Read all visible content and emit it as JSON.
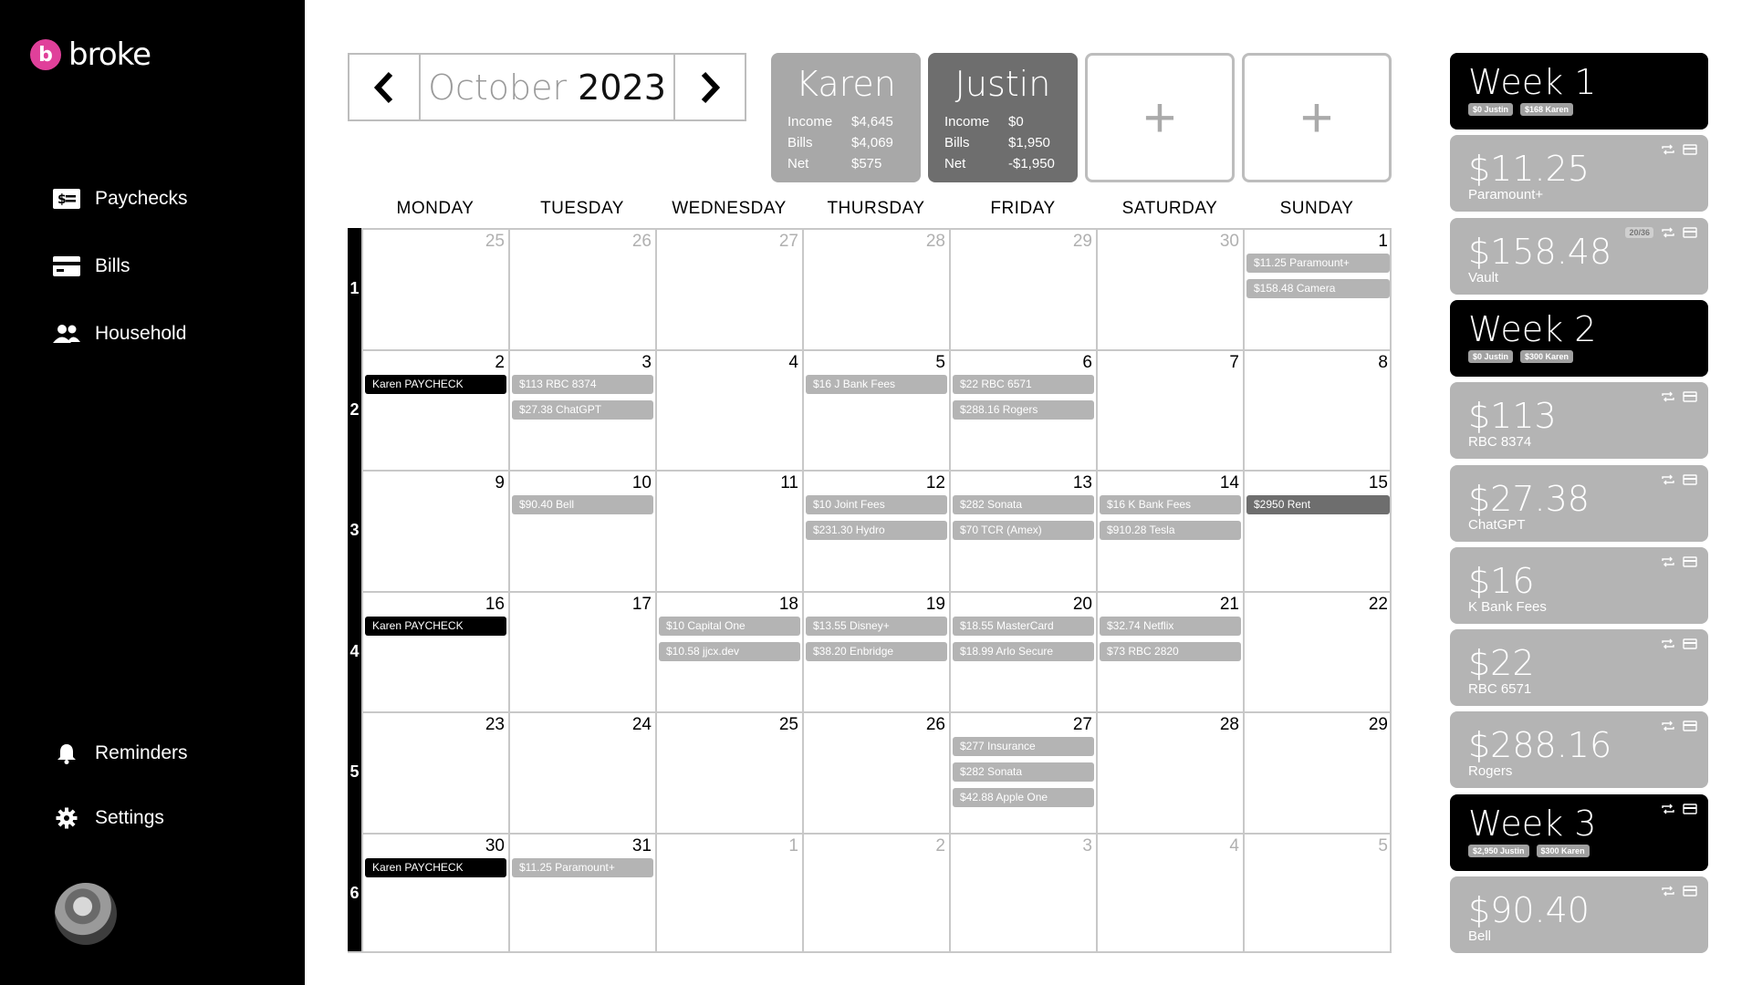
{
  "brand": {
    "name": "broke",
    "mark": "b",
    "accent": "#e0409a"
  },
  "nav": {
    "paychecks": "Paychecks",
    "bills": "Bills",
    "household": "Household",
    "reminders": "Reminders",
    "settings": "Settings"
  },
  "month": {
    "name": "October",
    "year": "2023"
  },
  "people": [
    {
      "name": "Karen",
      "income_label": "Income",
      "income": "$4,645",
      "bills_label": "Bills",
      "bills": "$4,069",
      "net_label": "Net",
      "net": "$575",
      "color": "#a8a8a8"
    },
    {
      "name": "Justin",
      "income_label": "Income",
      "income": "$0",
      "bills_label": "Bills",
      "bills": "$1,950",
      "net_label": "Net",
      "net": "-$1,950",
      "color": "#6e6e6e"
    }
  ],
  "add_label": "+",
  "days_of_week": [
    "MONDAY",
    "TUESDAY",
    "WEDNESDAY",
    "THURSDAY",
    "FRIDAY",
    "SATURDAY",
    "SUNDAY"
  ],
  "weeks": [
    "1",
    "2",
    "3",
    "4",
    "5",
    "6"
  ],
  "calendar": [
    [
      {
        "day": "25",
        "dim": true,
        "events": []
      },
      {
        "day": "26",
        "dim": true,
        "events": []
      },
      {
        "day": "27",
        "dim": true,
        "events": []
      },
      {
        "day": "28",
        "dim": true,
        "events": []
      },
      {
        "day": "29",
        "dim": true,
        "events": []
      },
      {
        "day": "30",
        "dim": true,
        "events": []
      },
      {
        "day": "1",
        "dim": false,
        "events": [
          {
            "label": "$11.25 Paramount+",
            "style": "grey"
          },
          {
            "label": "$158.48 Camera",
            "style": "grey"
          }
        ]
      }
    ],
    [
      {
        "day": "2",
        "dim": false,
        "events": [
          {
            "label": "Karen PAYCHECK",
            "style": "black"
          }
        ]
      },
      {
        "day": "3",
        "dim": false,
        "events": [
          {
            "label": "$113 RBC 8374",
            "style": "grey"
          },
          {
            "label": "$27.38 ChatGPT",
            "style": "grey"
          }
        ]
      },
      {
        "day": "4",
        "dim": false,
        "events": []
      },
      {
        "day": "5",
        "dim": false,
        "events": [
          {
            "label": "$16 J Bank Fees",
            "style": "grey"
          }
        ]
      },
      {
        "day": "6",
        "dim": false,
        "events": [
          {
            "label": "$22 RBC 6571",
            "style": "grey"
          },
          {
            "label": "$288.16 Rogers",
            "style": "grey"
          }
        ]
      },
      {
        "day": "7",
        "dim": false,
        "events": []
      },
      {
        "day": "8",
        "dim": false,
        "events": []
      }
    ],
    [
      {
        "day": "9",
        "dim": false,
        "events": []
      },
      {
        "day": "10",
        "dim": false,
        "events": [
          {
            "label": "$90.40 Bell",
            "style": "grey"
          }
        ]
      },
      {
        "day": "11",
        "dim": false,
        "events": []
      },
      {
        "day": "12",
        "dim": false,
        "events": [
          {
            "label": "$10 Joint Fees",
            "style": "grey"
          },
          {
            "label": "$231.30 Hydro",
            "style": "grey"
          }
        ]
      },
      {
        "day": "13",
        "dim": false,
        "events": [
          {
            "label": "$282 Sonata",
            "style": "grey"
          },
          {
            "label": "$70 TCR (Amex)",
            "style": "grey"
          }
        ]
      },
      {
        "day": "14",
        "dim": false,
        "events": [
          {
            "label": "$16 K Bank Fees",
            "style": "grey"
          },
          {
            "label": "$910.28 Tesla",
            "style": "grey"
          }
        ]
      },
      {
        "day": "15",
        "dim": false,
        "events": [
          {
            "label": "$2950 Rent",
            "style": "dark"
          }
        ]
      }
    ],
    [
      {
        "day": "16",
        "dim": false,
        "events": [
          {
            "label": "Karen PAYCHECK",
            "style": "black"
          }
        ]
      },
      {
        "day": "17",
        "dim": false,
        "events": []
      },
      {
        "day": "18",
        "dim": false,
        "events": [
          {
            "label": "$10 Capital One",
            "style": "grey"
          },
          {
            "label": "$10.58 jjcx.dev",
            "style": "grey"
          }
        ]
      },
      {
        "day": "19",
        "dim": false,
        "events": [
          {
            "label": "$13.55 Disney+",
            "style": "grey"
          },
          {
            "label": "$38.20 Enbridge",
            "style": "grey"
          }
        ]
      },
      {
        "day": "20",
        "dim": false,
        "events": [
          {
            "label": "$18.55 MasterCard",
            "style": "grey"
          },
          {
            "label": "$18.99 Arlo Secure",
            "style": "grey"
          }
        ]
      },
      {
        "day": "21",
        "dim": false,
        "events": [
          {
            "label": "$32.74 Netflix",
            "style": "grey"
          },
          {
            "label": "$73 RBC 2820",
            "style": "grey"
          }
        ]
      },
      {
        "day": "22",
        "dim": false,
        "events": []
      }
    ],
    [
      {
        "day": "23",
        "dim": false,
        "events": []
      },
      {
        "day": "24",
        "dim": false,
        "events": []
      },
      {
        "day": "25",
        "dim": false,
        "events": []
      },
      {
        "day": "26",
        "dim": false,
        "events": []
      },
      {
        "day": "27",
        "dim": false,
        "events": [
          {
            "label": "$277 Insurance",
            "style": "grey"
          },
          {
            "label": "$282 Sonata",
            "style": "grey"
          },
          {
            "label": "$42.88 Apple One",
            "style": "grey"
          }
        ]
      },
      {
        "day": "28",
        "dim": false,
        "events": []
      },
      {
        "day": "29",
        "dim": false,
        "events": []
      }
    ],
    [
      {
        "day": "30",
        "dim": false,
        "events": [
          {
            "label": "Karen PAYCHECK",
            "style": "black"
          }
        ]
      },
      {
        "day": "31",
        "dim": false,
        "events": [
          {
            "label": "$11.25 Paramount+",
            "style": "grey"
          }
        ]
      },
      {
        "day": "1",
        "dim": true,
        "events": []
      },
      {
        "day": "2",
        "dim": true,
        "events": []
      },
      {
        "day": "3",
        "dim": true,
        "events": []
      },
      {
        "day": "4",
        "dim": true,
        "events": []
      },
      {
        "day": "5",
        "dim": true,
        "events": []
      }
    ]
  ],
  "side_panel": [
    {
      "type": "week",
      "title": "Week 1",
      "badges": [
        "$0 Justin",
        "$168 Karen"
      ],
      "icons": false
    },
    {
      "type": "bill",
      "amount": "$11.25",
      "name": "Paramount+",
      "count": ""
    },
    {
      "type": "bill",
      "amount": "$158.48",
      "name": "Vault",
      "count": "20/36"
    },
    {
      "type": "week",
      "title": "Week 2",
      "badges": [
        "$0 Justin",
        "$300 Karen"
      ],
      "icons": false
    },
    {
      "type": "bill",
      "amount": "$113",
      "name": "RBC 8374",
      "count": ""
    },
    {
      "type": "bill",
      "amount": "$27.38",
      "name": "ChatGPT",
      "count": ""
    },
    {
      "type": "bill",
      "amount": "$16",
      "name": "K Bank Fees",
      "count": ""
    },
    {
      "type": "bill",
      "amount": "$22",
      "name": "RBC 6571",
      "count": ""
    },
    {
      "type": "bill",
      "amount": "$288.16",
      "name": "Rogers",
      "count": ""
    },
    {
      "type": "week",
      "title": "Week 3",
      "badges": [
        "$2,950 Justin",
        "$300 Karen"
      ],
      "icons": true
    },
    {
      "type": "bill",
      "amount": "$90.40",
      "name": "Bell",
      "count": ""
    }
  ],
  "colors": {
    "sidebar": "#000000",
    "chip_grey": "#b4b4b4",
    "chip_dark": "#6e6e6e",
    "grid": "#c8c8c8"
  }
}
